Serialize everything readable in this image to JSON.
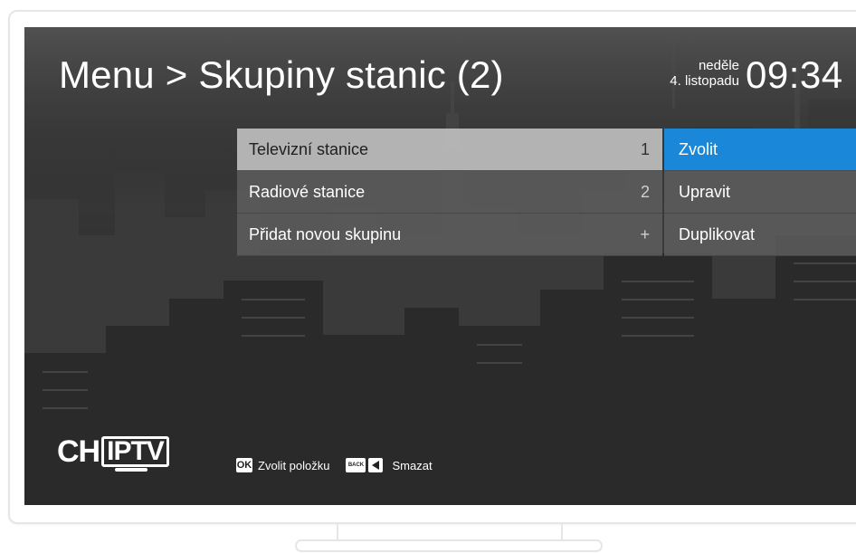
{
  "header": {
    "title": "Menu > Skupiny stanic (2)",
    "day": "neděle",
    "date": "4. listopadu",
    "time": "09:34"
  },
  "groups": [
    {
      "label": "Televizní stanice",
      "count": "1",
      "selected": true
    },
    {
      "label": "Radiové stanice",
      "count": "2",
      "selected": false
    },
    {
      "label": "Přidat novou skupinu",
      "count": "+",
      "selected": false
    }
  ],
  "actions": [
    {
      "label": "Zvolit",
      "highlighted": true
    },
    {
      "label": "Upravit",
      "highlighted": false
    },
    {
      "label": "Duplikovat",
      "highlighted": false
    }
  ],
  "logo": {
    "text_left": "CH",
    "text_box": "IPTV"
  },
  "hints": {
    "ok_key": "OK",
    "ok_label": "Zvolit položku",
    "back_key": "BACK",
    "back_label": "Smazat"
  },
  "colors": {
    "accent": "#1a87d8",
    "selected_row": "#bebebe",
    "row_bg": "#5f5f5f"
  }
}
